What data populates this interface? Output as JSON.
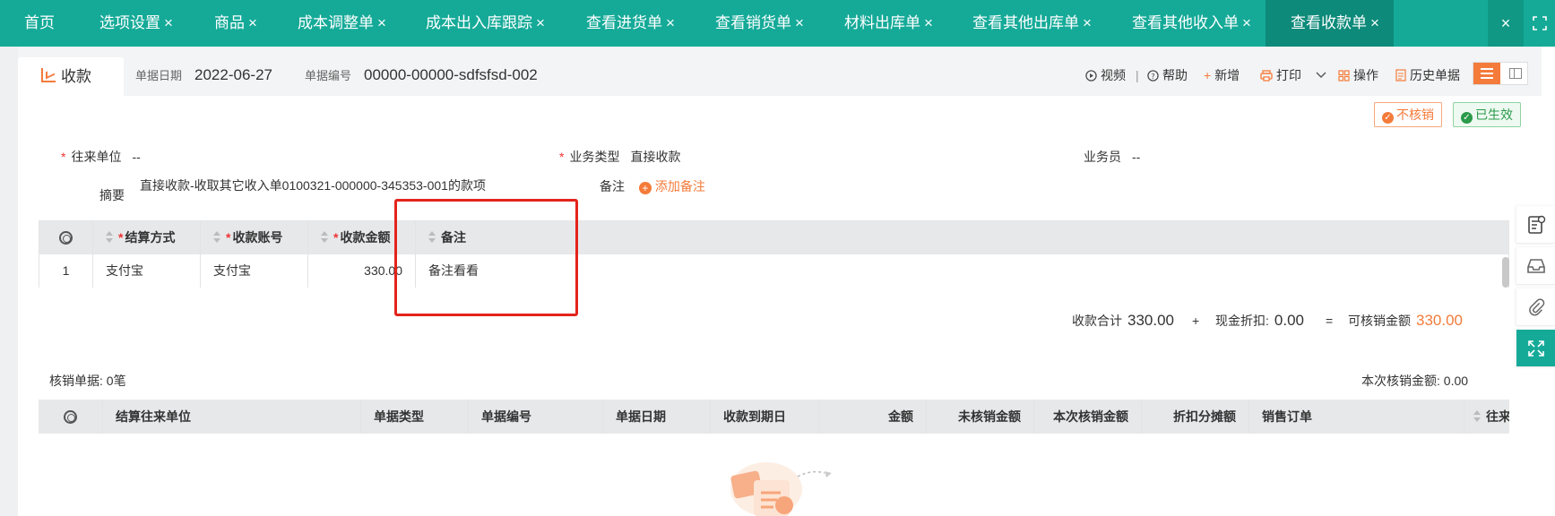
{
  "tabs": [
    {
      "label": "首页",
      "closable": false
    },
    {
      "label": "选项设置",
      "closable": true
    },
    {
      "label": "商品",
      "closable": true
    },
    {
      "label": "成本调整单",
      "closable": true
    },
    {
      "label": "成本出入库跟踪",
      "closable": true
    },
    {
      "label": "查看进货单",
      "closable": true
    },
    {
      "label": "查看销货单",
      "closable": true
    },
    {
      "label": "材料出库单",
      "closable": true
    },
    {
      "label": "查看其他出库单",
      "closable": true
    },
    {
      "label": "查看其他收入单",
      "closable": true
    },
    {
      "label": "查看收款单",
      "closable": true,
      "active": true
    }
  ],
  "close_glyph": "×",
  "tabbar_icons": {
    "close_all": "close-icon",
    "fullscreen": "fullscreen-icon"
  },
  "doc": {
    "tab_label": "收款",
    "date_label": "单据日期",
    "date_value": "2022-06-27",
    "number_label": "单据编号",
    "number_value": "00000-00000-sdfsfsd-002"
  },
  "toolbar": {
    "video": "视频",
    "separator": "|",
    "help": "帮助",
    "add": "新增",
    "print": "打印",
    "ops": "操作",
    "history": "历史单据"
  },
  "status": {
    "no_write_off": "不核销",
    "effective": "已生效"
  },
  "form": {
    "partner_label": "往来单位",
    "partner_value": "--",
    "biz_type_label": "业务类型",
    "biz_type_value": "直接收款",
    "salesman_label": "业务员",
    "salesman_value": "--",
    "memo_label": "摘要",
    "memo_value": "直接收款-收取其它收入单0100321-000000-345353-001的款项",
    "note_label": "备注",
    "add_note": "添加备注",
    "required_mark": "*"
  },
  "grid1": {
    "columns": [
      "结算方式",
      "收款账号",
      "收款金额",
      "备注"
    ],
    "rows": [
      {
        "index": "1",
        "method": "支付宝",
        "account": "支付宝",
        "amount": "330.00",
        "note": "备注看看"
      }
    ]
  },
  "totals": {
    "received_label": "收款合计",
    "received_value": "330.00",
    "plus": "+",
    "discount_label": "现金折扣:",
    "discount_value": "0.00",
    "equals": "=",
    "writable_label": "可核销金额",
    "writable_value": "330.00"
  },
  "writeoff": {
    "count_label": "核销单据: 0笔",
    "current_label": "本次核销金额: 0.00"
  },
  "grid2": {
    "columns": [
      "结算往来单位",
      "单据类型",
      "单据编号",
      "单据日期",
      "收款到期日",
      "金额",
      "未核销金额",
      "本次核销金额",
      "折扣分摊额",
      "销售订单",
      "往来"
    ]
  },
  "colors": {
    "tabbar": "#15aa98",
    "accent_orange": "#f47b3a",
    "green": "#2b9a4a",
    "highlight_red": "#e3241c"
  }
}
